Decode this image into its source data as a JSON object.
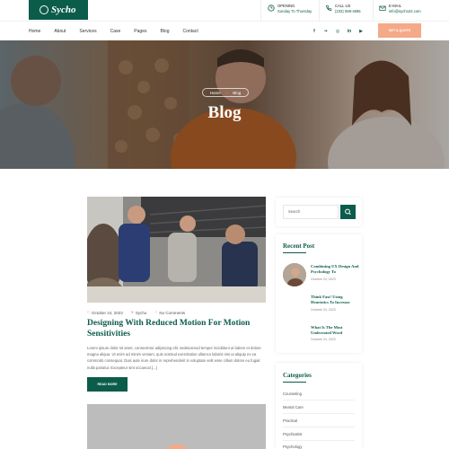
{
  "brand": {
    "name": "Sycho",
    "color": "#0c5c4b",
    "accent": "#f4a988"
  },
  "topbar": {
    "opening": {
      "label": "OPENING",
      "value": "Sunday To Thursday"
    },
    "call": {
      "label": "CALL US",
      "value": "(233) 598-4685"
    },
    "email": {
      "label": "E-MAIL",
      "value": "info@sycho24.com"
    }
  },
  "nav": {
    "items": [
      "Home",
      "About",
      "Services",
      "Case",
      "Pages",
      "Blog",
      "Contact"
    ],
    "social_icons": [
      "facebook-icon",
      "twitter-icon",
      "instagram-icon",
      "linkedin-icon",
      "youtube-icon"
    ],
    "social_glyphs": [
      "f",
      "❧",
      "◎",
      "in",
      "▶"
    ],
    "cta": "GET A QUOTE"
  },
  "hero": {
    "breadcrumb": [
      "Home",
      "Blog"
    ],
    "title": "Blog"
  },
  "post": {
    "date": "October 24, 2023",
    "author": "Sycho",
    "comments": "No Comments",
    "title": "Designing With Reduced Motion For Motion Sensitivities",
    "excerpt": "Lorem ipsum dolor sit amet, consectetur adipiscing elit, sedeiusmod tempor incididunt ut labore et dolore magna aliqua. Ut enim ad minim veniam, quis nostrud exercitation ullamco laboris nisi ut aliquip ex ea commodo consequat. Duis aute irure dolor in reprehenderit in voluptate velit esse cillum dolore eu fugiat nulla pariatur. Excepteur sint occaecat [...]",
    "read_more": "READ MORE"
  },
  "sidebar": {
    "search_placeholder": "Search",
    "recent_title": "Recent Post",
    "recent": [
      {
        "title": "Combining UX Design And Psychology To",
        "date": "Octobre 24, 2023"
      },
      {
        "title": "Think Fast! Using Heuristics To Increase",
        "date": "Octobre 24, 2023"
      },
      {
        "title": "What Is The Most Underrated Word",
        "date": "Octobre 24, 2023"
      }
    ],
    "categories_title": "Categories",
    "categories": [
      "Counseling",
      "Mental Care",
      "Practical",
      "Psychiatrist",
      "Psychology"
    ]
  }
}
